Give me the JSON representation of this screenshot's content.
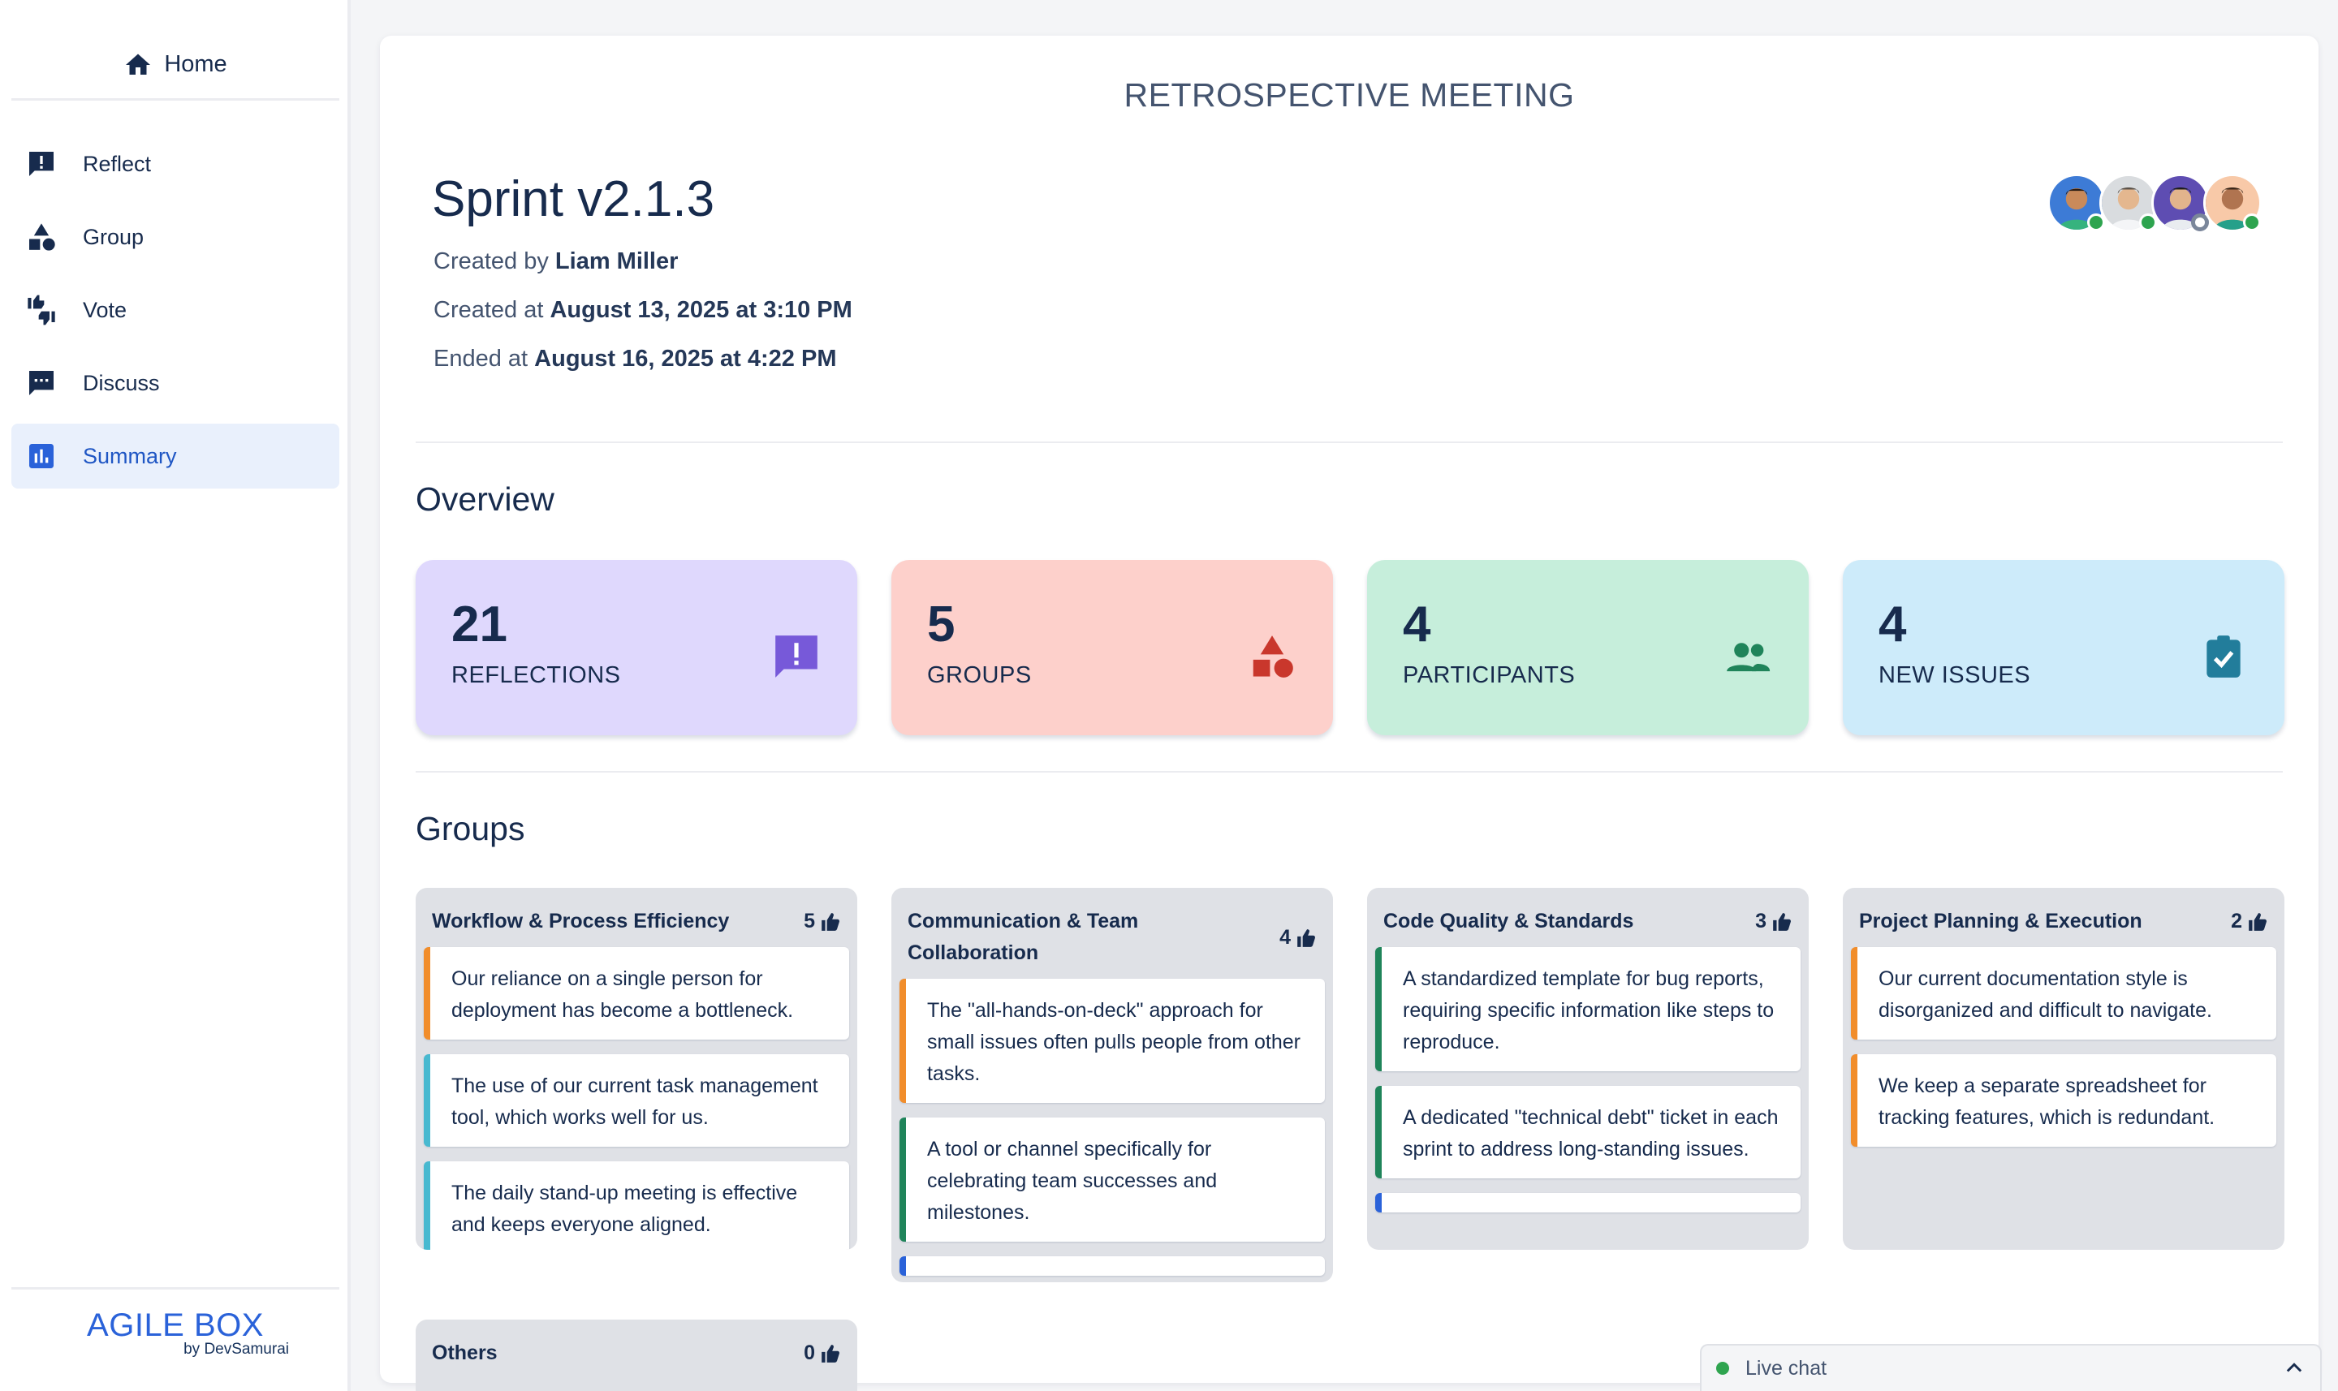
{
  "sidebar": {
    "home_label": "Home",
    "items": [
      {
        "label": "Reflect",
        "icon": "reflect-icon"
      },
      {
        "label": "Group",
        "icon": "shapes-icon"
      },
      {
        "label": "Vote",
        "icon": "thumbs-icon"
      },
      {
        "label": "Discuss",
        "icon": "chat-icon"
      },
      {
        "label": "Summary",
        "icon": "bar-chart-icon",
        "active": true
      }
    ],
    "brand": "AGILE BOX",
    "brand_sub": "by DevSamurai"
  },
  "header": {
    "page_title": "RETROSPECTIVE MEETING",
    "sprint_title": "Sprint v2.1.3",
    "created_by_label": "Created by",
    "created_by": "Liam Miller",
    "created_at_label": "Created at",
    "created_at": "August 13, 2025 at 3:10 PM",
    "ended_at_label": "Ended at",
    "ended_at": "August 16, 2025 at 4:22 PM"
  },
  "participants": [
    {
      "avatar": "avatar-1",
      "status": "online"
    },
    {
      "avatar": "avatar-2",
      "status": "online"
    },
    {
      "avatar": "avatar-3",
      "status": "away"
    },
    {
      "avatar": "avatar-4",
      "status": "online"
    }
  ],
  "overview": {
    "title": "Overview",
    "stats": [
      {
        "value": "21",
        "label": "REFLECTIONS",
        "icon": "reflection-icon",
        "color": "#7759d9"
      },
      {
        "value": "5",
        "label": "GROUPS",
        "icon": "shapes-icon",
        "color": "#c9372c"
      },
      {
        "value": "4",
        "label": "PARTICIPANTS",
        "icon": "people-icon",
        "color": "#1f845a"
      },
      {
        "value": "4",
        "label": "NEW ISSUES",
        "icon": "clipboard-check-icon",
        "color": "#227d9b"
      }
    ]
  },
  "groups": {
    "title": "Groups",
    "columns": [
      {
        "name": "Workflow & Process Efficiency",
        "votes": "5",
        "cards": [
          {
            "text": "Our reliance on a single person for deployment has become a bottleneck.",
            "color": "orange"
          },
          {
            "text": "The use of our current task management tool, which works well for us.",
            "color": "teal"
          },
          {
            "text": "The daily stand-up meeting is effective and keeps everyone aligned.",
            "color": "teal"
          }
        ]
      },
      {
        "name": "Communication & Team Collaboration",
        "votes": "4",
        "cards": [
          {
            "text": "The \"all-hands-on-deck\" approach for small issues often pulls people from other tasks.",
            "color": "orange"
          },
          {
            "text": "A tool or channel specifically for celebrating team successes and milestones.",
            "color": "green"
          }
        ]
      },
      {
        "name": "Code Quality & Standards",
        "votes": "3",
        "cards": [
          {
            "text": "A standardized template for bug reports, requiring specific information like steps to reproduce.",
            "color": "green"
          },
          {
            "text": "A dedicated \"technical debt\" ticket in each sprint to address long-standing issues.",
            "color": "green"
          }
        ]
      },
      {
        "name": "Project Planning & Execution",
        "votes": "2",
        "cards": [
          {
            "text": "Our current documentation style is disorganized and difficult to navigate.",
            "color": "orange"
          },
          {
            "text": "We keep a separate spreadsheet for tracking features, which is redundant.",
            "color": "orange"
          }
        ]
      },
      {
        "name": "Others",
        "votes": "0",
        "cards": []
      }
    ]
  },
  "livechat": {
    "label": "Live chat"
  }
}
